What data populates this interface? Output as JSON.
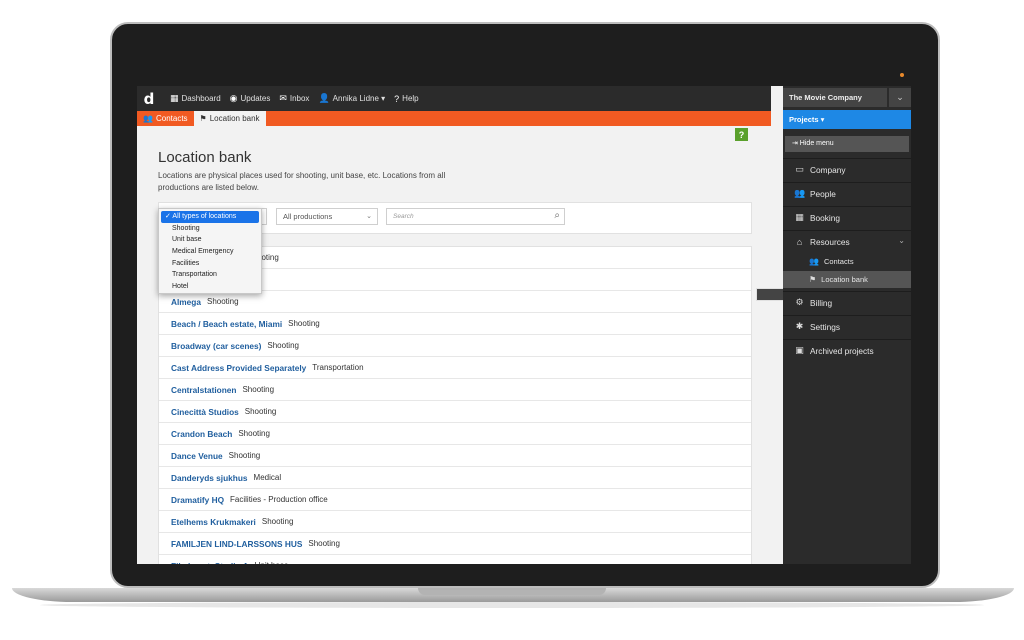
{
  "topbar": {
    "logo": "d",
    "items": [
      {
        "icon": "dashboard-icon",
        "glyph": "▦",
        "label": "Dashboard"
      },
      {
        "icon": "updates-icon",
        "glyph": "◉",
        "label": "Updates"
      },
      {
        "icon": "inbox-icon",
        "glyph": "✉",
        "label": "Inbox"
      },
      {
        "icon": "user-icon",
        "glyph": "👤",
        "label": "Annika Lidne ▾"
      },
      {
        "icon": "help-icon",
        "glyph": "?",
        "label": "Help"
      }
    ]
  },
  "tabs": [
    {
      "label": "Contacts",
      "glyph": "👥"
    },
    {
      "label": "Location bank",
      "glyph": "⚑"
    }
  ],
  "page": {
    "title": "Location bank",
    "description": "Locations are physical places used for shooting, unit base, etc. Locations from all productions are listed below."
  },
  "filters": {
    "production_value": "All productions",
    "search_placeholder": "Search",
    "type_options": [
      "✓ All types of locations",
      "Shooting",
      "Unit base",
      "Medical Emergency",
      "Facilities",
      "Transportation",
      "Hotel"
    ]
  },
  "locations": [
    {
      "name": "",
      "type": "ooting"
    },
    {
      "name": "",
      "type": ""
    },
    {
      "name": "Almega",
      "type": "Shooting"
    },
    {
      "name": "Beach / Beach estate, Miami",
      "type": "Shooting"
    },
    {
      "name": "Broadway (car scenes)",
      "type": "Shooting"
    },
    {
      "name": "Cast Address Provided Separately",
      "type": "Transportation"
    },
    {
      "name": "Centralstationen",
      "type": "Shooting"
    },
    {
      "name": "Cinecittà Studios",
      "type": "Shooting"
    },
    {
      "name": "Crandon Beach",
      "type": "Shooting"
    },
    {
      "name": "Dance Venue",
      "type": "Shooting"
    },
    {
      "name": "Danderyds sjukhus",
      "type": "Medical"
    },
    {
      "name": "Dramatify HQ",
      "type": "Facilities - Production office"
    },
    {
      "name": "Etelhems Krukmakeri",
      "type": "Shooting"
    },
    {
      "name": "FAMILJEN LIND-LARSSONS HUS",
      "type": "Shooting"
    },
    {
      "name": "Filmhuset, Studio A",
      "type": "Unit base"
    }
  ],
  "sidebar": {
    "company": "The Movie Company",
    "projects": "Projects ▾",
    "hide_menu": "⇥ Hide menu",
    "items": [
      {
        "label": "Company",
        "glyph": "▭"
      },
      {
        "label": "People",
        "glyph": "👥"
      },
      {
        "label": "Booking",
        "glyph": "▦"
      },
      {
        "label": "Resources",
        "glyph": "⌂"
      },
      {
        "label": "Billing",
        "glyph": "⚙"
      },
      {
        "label": "Settings",
        "glyph": "✱"
      },
      {
        "label": "Archived projects",
        "glyph": "▣"
      }
    ],
    "sub_items": [
      {
        "label": "Contacts",
        "glyph": "👥"
      },
      {
        "label": "Location bank",
        "glyph": "⚑"
      }
    ]
  },
  "colors": {
    "accent_orange": "#f15a22",
    "accent_blue": "#1e88e5",
    "link_blue": "#1f5e9e",
    "help_green": "#5aa02c"
  }
}
